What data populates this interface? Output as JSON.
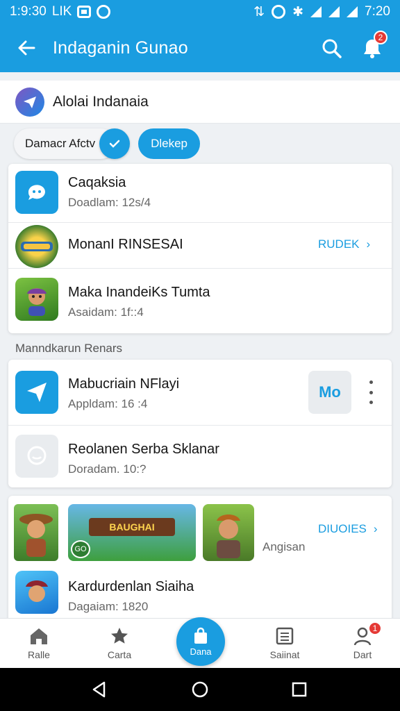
{
  "status_bar": {
    "time_left": "1:9:30",
    "carrier": "LIK",
    "time_right": "7:20"
  },
  "app_bar": {
    "title": "Indaganin Gunao",
    "notification_count": "2"
  },
  "account": {
    "name": "Alolai Indanaia"
  },
  "filters": {
    "chip_plain": "Damacr Afctv",
    "chip_active": "Dlekep"
  },
  "top_card": [
    {
      "title": "Caqaksia",
      "subtitle": "Doadlam: 12s/4",
      "icon": "chat-bot-icon"
    },
    {
      "title": "MonanI RINSESAI",
      "link": "RUDEK",
      "icon": "game-badge-icon"
    },
    {
      "title": "Maka InandeiKs Tumta",
      "subtitle": "Asaidam: 1f::4",
      "icon": "character-icon"
    }
  ],
  "section_title": "Manndkarun Renars",
  "mid_card": [
    {
      "title": "Mabucriain NFlayi",
      "subtitle": "Appldam: 16 :4",
      "icon": "send-icon",
      "action": "Mo"
    },
    {
      "title": "Reolanen Serba Sklanar",
      "subtitle": "Doradam. 10:?",
      "icon": "chat-bubble-icon"
    }
  ],
  "media_card": {
    "banner_text": "BAUGHAI",
    "banner_badge": "GO",
    "link": "DIUOIES",
    "caption": "Angisan",
    "item": {
      "title": "Kardurdenlan Siaiha",
      "subtitle": "Dagaiam: 1820"
    }
  },
  "bottom_nav": [
    {
      "label": "Ralle",
      "icon": "home-icon"
    },
    {
      "label": "Carta",
      "icon": "star-icon"
    },
    {
      "label": "Dana",
      "icon": "bag-icon"
    },
    {
      "label": "Saiinat",
      "icon": "list-icon"
    },
    {
      "label": "Dart",
      "icon": "person-icon",
      "badge": "1"
    }
  ],
  "colors": {
    "accent": "#1a9de0",
    "badge": "#e53935"
  }
}
